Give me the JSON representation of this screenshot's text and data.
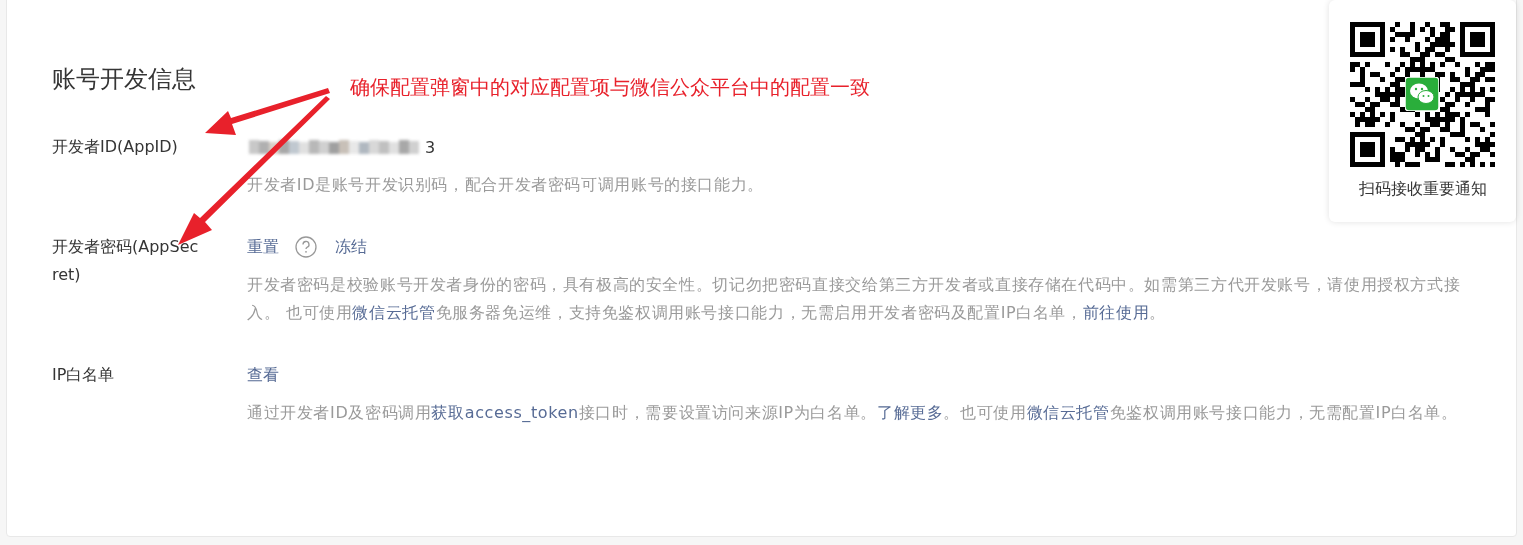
{
  "section": {
    "title": "账号开发信息"
  },
  "annotation": {
    "text": "确保配置弹窗中的对应配置项与微信公众平台中的配置一致"
  },
  "fields": [
    {
      "label": "开发者ID(AppID)",
      "kind": "value",
      "value": "3",
      "description": [
        {
          "text": "开发者ID是账号开发识别码，配合开发者密码可调用账号的接口能力。",
          "link": false
        }
      ]
    },
    {
      "label": "开发者密码(AppSecret)",
      "kind": "actions",
      "actions": [
        {
          "label": "重置",
          "help": true
        },
        {
          "label": "冻结",
          "help": false
        }
      ],
      "description": [
        {
          "text": "开发者密码是校验账号开发者身份的密码，具有极高的安全性。切记勿把密码直接交给第三方开发者或直接存储在代码中。如需第三方代开发账号，请使用授权方式接入。 也可使用",
          "link": false
        },
        {
          "text": "微信云托管",
          "link": true
        },
        {
          "text": "免服务器免运维，支持免鉴权调用账号接口能力，无需启用开发者密码及配置IP白名单，",
          "link": false
        },
        {
          "text": "前往使用",
          "link": true
        },
        {
          "text": "。",
          "link": false
        }
      ]
    },
    {
      "label": "IP白名单",
      "kind": "actions",
      "actions": [
        {
          "label": "查看",
          "help": false
        }
      ],
      "description": [
        {
          "text": "通过开发者ID及密码调用",
          "link": false
        },
        {
          "text": "获取access_token",
          "link": true
        },
        {
          "text": "接口时，需要设置访问来源IP为白名单。",
          "link": false
        },
        {
          "text": "了解更多",
          "link": true
        },
        {
          "text": "。也可使用",
          "link": false
        },
        {
          "text": "微信云托管",
          "link": true
        },
        {
          "text": "免鉴权调用账号接口能力，无需配置IP白名单。",
          "link": false
        }
      ]
    }
  ],
  "qr_panel": {
    "caption": "扫码接收重要通知"
  }
}
